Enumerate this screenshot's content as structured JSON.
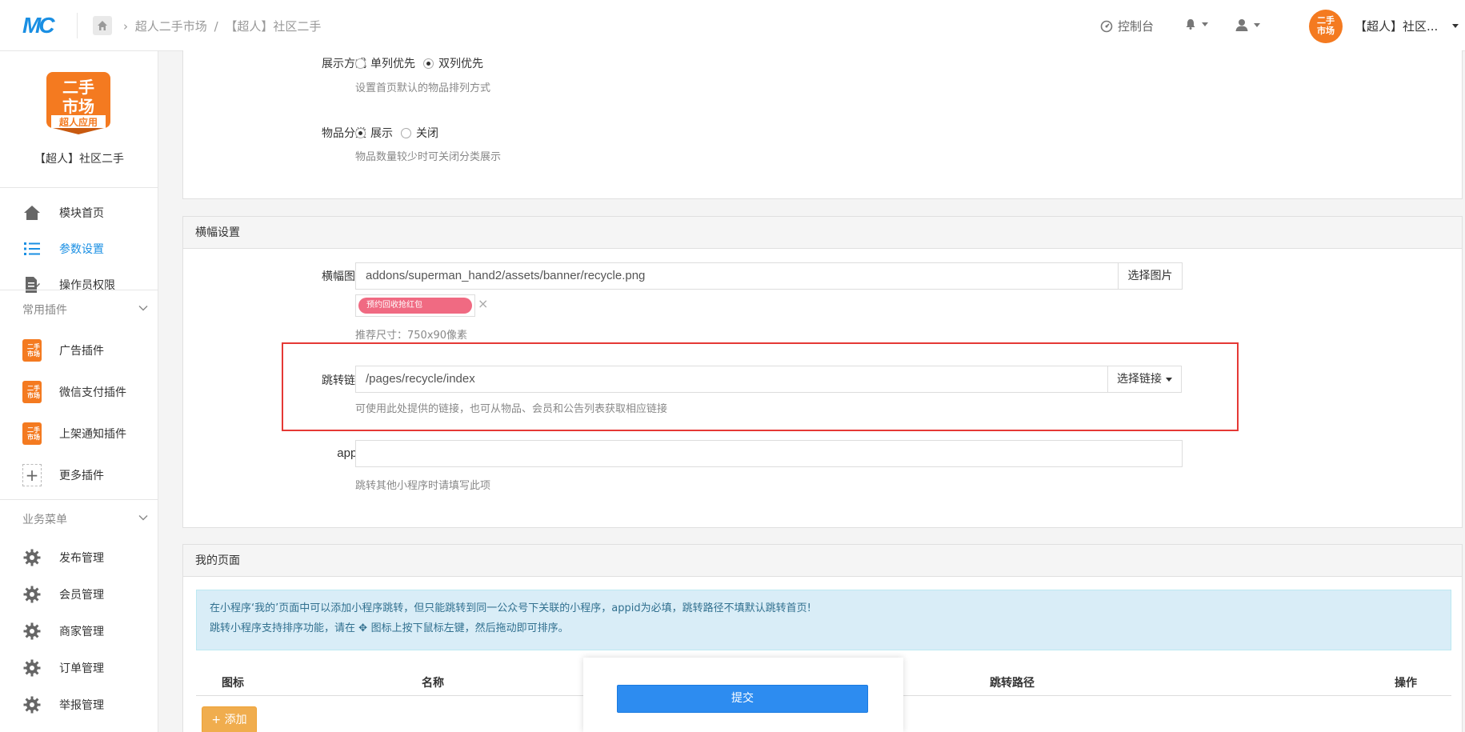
{
  "header": {
    "logo_text": "MC",
    "breadcrumb": [
      "超人二手市场",
      "/",
      "【超人】社区二手"
    ],
    "console_label": "控制台",
    "account_name": "【超人】社区..."
  },
  "sidebar": {
    "app_logo_lines": [
      "二手",
      "市场",
      "超人应用"
    ],
    "app_name": "【超人】社区二手",
    "main_items": [
      {
        "label": "模块首页",
        "icon": "home-icon"
      },
      {
        "label": "参数设置",
        "icon": "list-icon",
        "active": true
      },
      {
        "label": "操作员权限",
        "icon": "document-edit-icon"
      }
    ],
    "plugins_title": "常用插件",
    "plugins": [
      {
        "label": "广告插件"
      },
      {
        "label": "微信支付插件"
      },
      {
        "label": "上架通知插件"
      },
      {
        "label": "更多插件"
      }
    ],
    "business_title": "业务菜单",
    "business_items": [
      {
        "label": "发布管理"
      },
      {
        "label": "会员管理"
      },
      {
        "label": "商家管理"
      },
      {
        "label": "订单管理"
      },
      {
        "label": "举报管理"
      }
    ]
  },
  "display_section": {
    "display_mode": {
      "label": "展示方式",
      "options": [
        "单列优先",
        "双列优先"
      ],
      "selected": "双列优先",
      "help": "设置首页默认的物品排列方式"
    },
    "category": {
      "label": "物品分类",
      "options": [
        "展示",
        "关闭"
      ],
      "selected": "展示",
      "help": "物品数量较少时可关闭分类展示"
    }
  },
  "banner_section": {
    "title": "横幅设置",
    "image_label": "横幅图片",
    "image_value": "addons/superman_hand2/assets/banner/recycle.png",
    "image_button": "选择图片",
    "thumb_text": "预约回收抢红包",
    "size_hint": "推荐尺寸：750x90像素",
    "link_label": "跳转链接",
    "link_value": "/pages/recycle/index",
    "link_button": "选择链接",
    "link_help": "可使用此处提供的链接，也可从物品、会员和公告列表获取相应链接",
    "appid_label": "appid",
    "appid_value": "",
    "appid_help": "跳转其他小程序时请填写此项"
  },
  "my_page_section": {
    "title": "我的页面",
    "info_line1": "在小程序‘我的’页面中可以添加小程序跳转，但只能跳转到同一公众号下关联的小程序，appid为必填，跳转路径不填默认跳转首页!",
    "info_line2_pre": "跳转小程序支持排序功能，请在",
    "info_line2_post": "图标上按下鼠标左键，然后拖动即可排序。",
    "columns": [
      "图标",
      "名称",
      "跳转路径",
      "操作"
    ],
    "add_button": "+ 添加"
  },
  "submit_label": "提交",
  "colors": {
    "accent": "#1a8fe3",
    "highlight": "#e53935",
    "submit": "#2d8cf0",
    "add": "#f0ad4e",
    "brand_orange": "#f47a20"
  }
}
